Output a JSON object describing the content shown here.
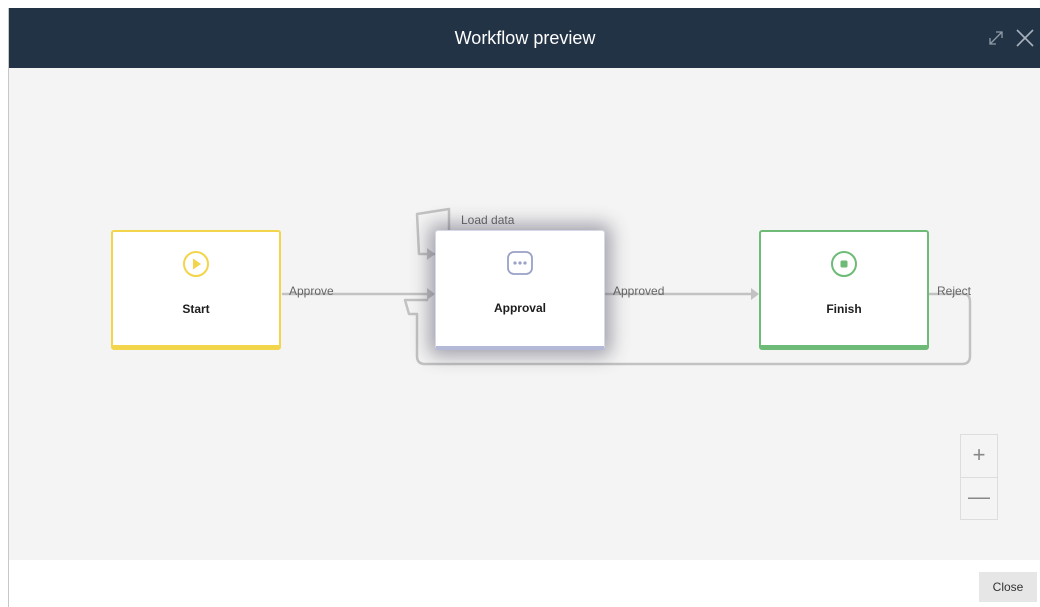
{
  "dialog": {
    "title": "Workflow preview",
    "expand_icon": "expand-icon",
    "close_icon": "close-icon"
  },
  "nodes": {
    "start": {
      "label": "Start",
      "icon": "play-circle-icon",
      "color": "#f2d54a"
    },
    "approval": {
      "label": "Approval",
      "icon": "more-dots-icon",
      "color": "#b3b9d6"
    },
    "finish": {
      "label": "Finish",
      "icon": "stop-circle-icon",
      "color": "#6dbb76"
    }
  },
  "edges": {
    "approve": "Approve",
    "load_data": "Load data",
    "approved": "Approved",
    "reject": "Reject"
  },
  "zoom": {
    "in": "+",
    "out": "—"
  },
  "footer": {
    "close_label": "Close"
  }
}
